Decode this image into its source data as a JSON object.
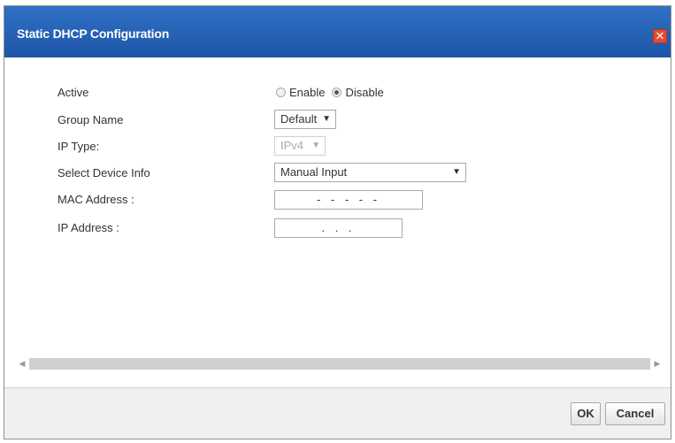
{
  "dialog": {
    "title": "Static DHCP Configuration",
    "close_glyph": "✕"
  },
  "form": {
    "active": {
      "label": "Active",
      "options": [
        "Enable",
        "Disable"
      ],
      "selected": "Disable"
    },
    "group_name": {
      "label": "Group Name",
      "value": "Default"
    },
    "ip_type": {
      "label": "IP Type:",
      "value": "IPv4",
      "disabled": true
    },
    "select_device_info": {
      "label": "Select Device Info",
      "value": "Manual Input"
    },
    "mac_address": {
      "label": "MAC Address :",
      "value": "- - - - -"
    },
    "ip_address": {
      "label": "IP Address :",
      "value": ". . ."
    }
  },
  "buttons": {
    "ok": "OK",
    "cancel": "Cancel"
  },
  "icons": {
    "dropdown": "caret-down-icon",
    "scroll_left": "arrow-left-icon",
    "scroll_right": "arrow-right-icon"
  }
}
